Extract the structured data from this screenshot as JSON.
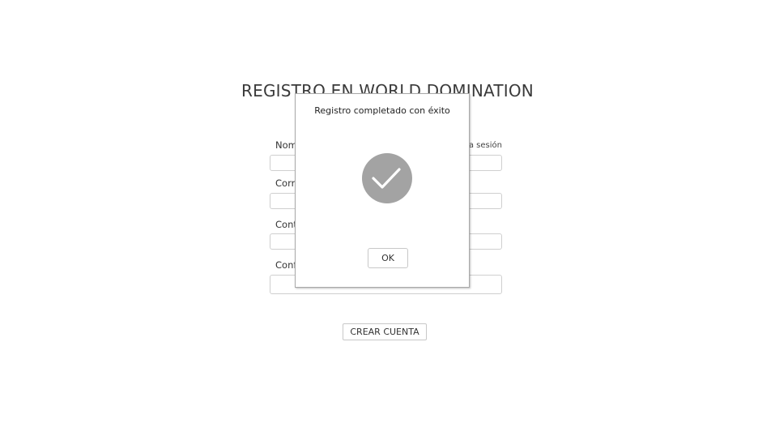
{
  "form": {
    "title": "REGISTRO EN WORLD DOMINATION",
    "login_link": "Inicia sesión",
    "fields": [
      {
        "label": "Nombre de usuario",
        "value": ""
      },
      {
        "label": "Correo electrónico",
        "value": ""
      },
      {
        "label": "Contraseña",
        "value": ""
      },
      {
        "label": "Confirmar contraseña",
        "value": ""
      }
    ],
    "submit_label": "CREAR CUENTA"
  },
  "dialog": {
    "message": "Registro completado con éxito",
    "icon": "checkmark-icon",
    "icon_color": "#a3a3a3",
    "ok_label": "OK"
  }
}
